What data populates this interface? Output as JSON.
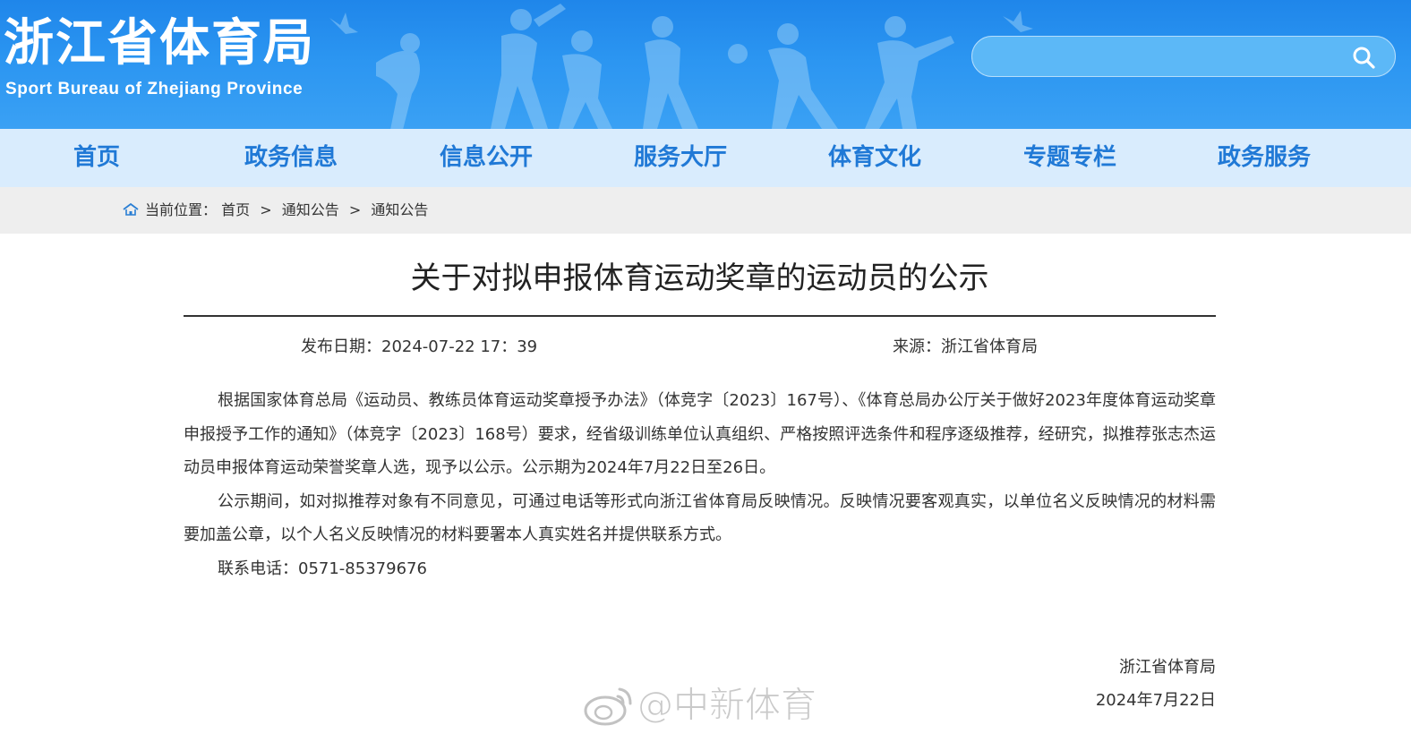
{
  "header": {
    "logo_cn": "浙江省体育局",
    "logo_en": "Sport Bureau of Zhejiang Province",
    "search_value": "",
    "search_icon": "search-icon"
  },
  "nav": {
    "items": [
      {
        "label": "首页"
      },
      {
        "label": "政务信息"
      },
      {
        "label": "信息公开"
      },
      {
        "label": "服务大厅"
      },
      {
        "label": "体育文化"
      },
      {
        "label": "专题专栏"
      },
      {
        "label": "政务服务"
      }
    ]
  },
  "breadcrumb": {
    "prefix": "当前位置：",
    "items": [
      "首页",
      "通知公告",
      "通知公告"
    ],
    "separator": ">"
  },
  "article": {
    "title": "关于对拟申报体育运动奖章的运动员的公示",
    "date": "发布日期：2024-07-22  17：39",
    "source": "来源：浙江省体育局",
    "paragraphs": [
      "根据国家体育总局《运动员、教练员体育运动奖章授予办法》（体竞字〔2023〕167号）、《体育总局办公厅关于做好2023年度体育运动奖章申报授予工作的通知》（体竞字〔2023〕168号）要求，经省级训练单位认真组织、严格按照评选条件和程序逐级推荐，经研究，拟推荐张志杰运动员申报体育运动荣誉奖章人选，现予以公示。公示期为2024年7月22日至26日。",
      "公示期间，如对拟推荐对象有不同意见，可通过电话等形式向浙江省体育局反映情况。反映情况要客观真实，以单位名义反映情况的材料需要加盖公章，以个人名义反映情况的材料要署本人真实姓名并提供联系方式。",
      "联系电话：0571-85379676"
    ],
    "signature_org": "浙江省体育局",
    "signature_date": "2024年7月22日"
  },
  "watermark": {
    "text": "@中新体育"
  },
  "colors": {
    "header_bg": "#2b95f1",
    "nav_bg": "#d9ecfd",
    "nav_text": "#2079d6",
    "crumb_bg": "#eeeeee"
  }
}
